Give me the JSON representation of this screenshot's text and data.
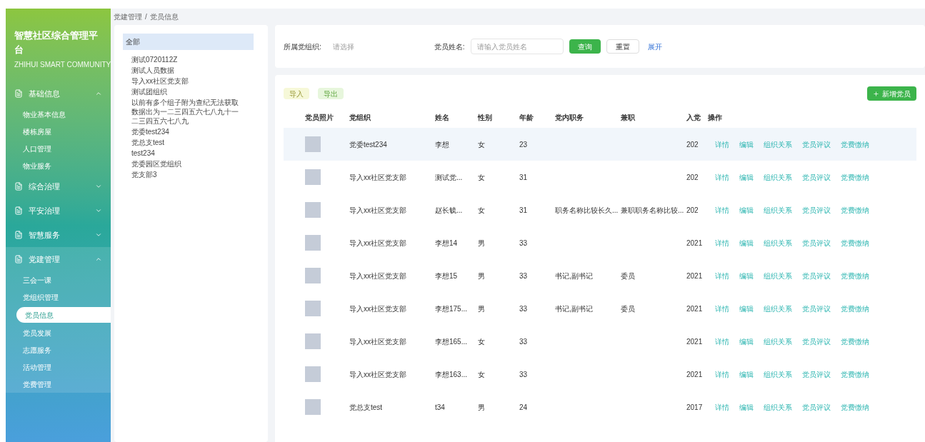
{
  "app": {
    "title": "智慧社区综合管理平台",
    "subtitle": "ZHIHUI SMART COMMUNITY"
  },
  "sidebar": {
    "groups": [
      {
        "label": "基础信息",
        "expanded": true,
        "children": [
          {
            "label": "物业基本信息",
            "selected": false
          },
          {
            "label": "楼栋房屋",
            "selected": false
          },
          {
            "label": "人口管理",
            "selected": false
          },
          {
            "label": "物业服务",
            "selected": false
          }
        ]
      },
      {
        "label": "综合治理",
        "expanded": false
      },
      {
        "label": "平安治理",
        "expanded": false
      },
      {
        "label": "智慧服务",
        "expanded": false
      },
      {
        "label": "党建管理",
        "expanded": true,
        "children": [
          {
            "label": "三会一课",
            "selected": false
          },
          {
            "label": "党组织管理",
            "selected": false
          },
          {
            "label": "党员信息",
            "selected": true
          },
          {
            "label": "党员发展",
            "selected": false
          },
          {
            "label": "志愿服务",
            "selected": false
          },
          {
            "label": "活动管理",
            "selected": false
          },
          {
            "label": "党费管理",
            "selected": false
          }
        ]
      }
    ]
  },
  "breadcrumb": {
    "items": [
      "党建管理",
      "党员信息"
    ],
    "separator": "/"
  },
  "tree": [
    {
      "label": "全部",
      "selected": true
    },
    {
      "label": "测试0720112Z",
      "selected": false
    },
    {
      "label": "测试人员数据",
      "selected": false
    },
    {
      "label": "导入xx社区党支部",
      "selected": false
    },
    {
      "label": "测试团组织",
      "selected": false
    },
    {
      "label": "以前有多个组子附为查纪无法获取数据出为一二三四五六七八九十一二三四五六七八九",
      "selected": false
    },
    {
      "label": "党委test234",
      "selected": false
    },
    {
      "label": "党总支test",
      "selected": false
    },
    {
      "label": "test234",
      "selected": false
    },
    {
      "label": "党委园区党组织",
      "selected": false
    },
    {
      "label": "党支部3",
      "selected": false
    }
  ],
  "filter": {
    "org_label": "所属党组织:",
    "org_placeholder": "请选择",
    "name_label": "党员姓名:",
    "name_placeholder": "请输入党员姓名",
    "search": "查询",
    "reset": "重置",
    "expand": "展开"
  },
  "toolbar": {
    "import": "导入",
    "export": "导出",
    "add": "新增党员"
  },
  "table": {
    "columns": [
      "党员照片",
      "党组织",
      "姓名",
      "性别",
      "年龄",
      "党内职务",
      "兼职",
      "入党",
      "操作"
    ],
    "rows": [
      {
        "org": "党委test234",
        "name": "李想",
        "gender": "女",
        "age": "23",
        "duty": "",
        "parttime": "",
        "joined": "202",
        "selected": true,
        "actions": [
          "详情",
          "编辑",
          "组织关系",
          "党员评议",
          "党费缴纳"
        ]
      },
      {
        "org": "导入xx社区党支部",
        "name": "测试党...",
        "gender": "女",
        "age": "31",
        "duty": "",
        "parttime": "",
        "joined": "202",
        "selected": false,
        "actions": [
          "详情",
          "编辑",
          "组织关系",
          "党员评议",
          "党费缴纳"
        ]
      },
      {
        "org": "导入xx社区党支部",
        "name": "赵长毓...",
        "gender": "女",
        "age": "31",
        "duty": "职务名称比较长久...",
        "parttime": "兼职职务名称比较...",
        "joined": "202",
        "selected": false,
        "actions": [
          "详情",
          "编辑",
          "组织关系",
          "党员评议",
          "党费缴纳"
        ]
      },
      {
        "org": "导入xx社区党支部",
        "name": "李想14",
        "gender": "男",
        "age": "33",
        "duty": "",
        "parttime": "",
        "joined": "2021",
        "selected": false,
        "actions": [
          "详情",
          "编辑",
          "组织关系",
          "党员评议",
          "党费缴纳"
        ]
      },
      {
        "org": "导入xx社区党支部",
        "name": "李想15",
        "gender": "男",
        "age": "33",
        "duty": "书记,副书记",
        "parttime": "委员",
        "joined": "2021",
        "selected": false,
        "actions": [
          "详情",
          "编辑",
          "组织关系",
          "党员评议",
          "党费缴纳"
        ]
      },
      {
        "org": "导入xx社区党支部",
        "name": "李想175...",
        "gender": "男",
        "age": "33",
        "duty": "书记,副书记",
        "parttime": "委员",
        "joined": "2021",
        "selected": false,
        "actions": [
          "详情",
          "编辑",
          "组织关系",
          "党员评议",
          "党费缴纳"
        ]
      },
      {
        "org": "导入xx社区党支部",
        "name": "李想165...",
        "gender": "女",
        "age": "33",
        "duty": "",
        "parttime": "",
        "joined": "2021",
        "selected": false,
        "actions": [
          "详情",
          "编辑",
          "组织关系",
          "党员评议",
          "党费缴纳"
        ]
      },
      {
        "org": "导入xx社区党支部",
        "name": "李想163...",
        "gender": "女",
        "age": "33",
        "duty": "",
        "parttime": "",
        "joined": "2021",
        "selected": false,
        "actions": [
          "详情",
          "编辑",
          "组织关系",
          "党员评议",
          "党费缴纳"
        ]
      },
      {
        "org": "党总支test",
        "name": "t34",
        "gender": "男",
        "age": "24",
        "duty": "",
        "parttime": "",
        "joined": "2017",
        "selected": false,
        "actions": [
          "详情",
          "编辑",
          "组织关系",
          "党员评议",
          "党费缴纳"
        ]
      }
    ]
  }
}
